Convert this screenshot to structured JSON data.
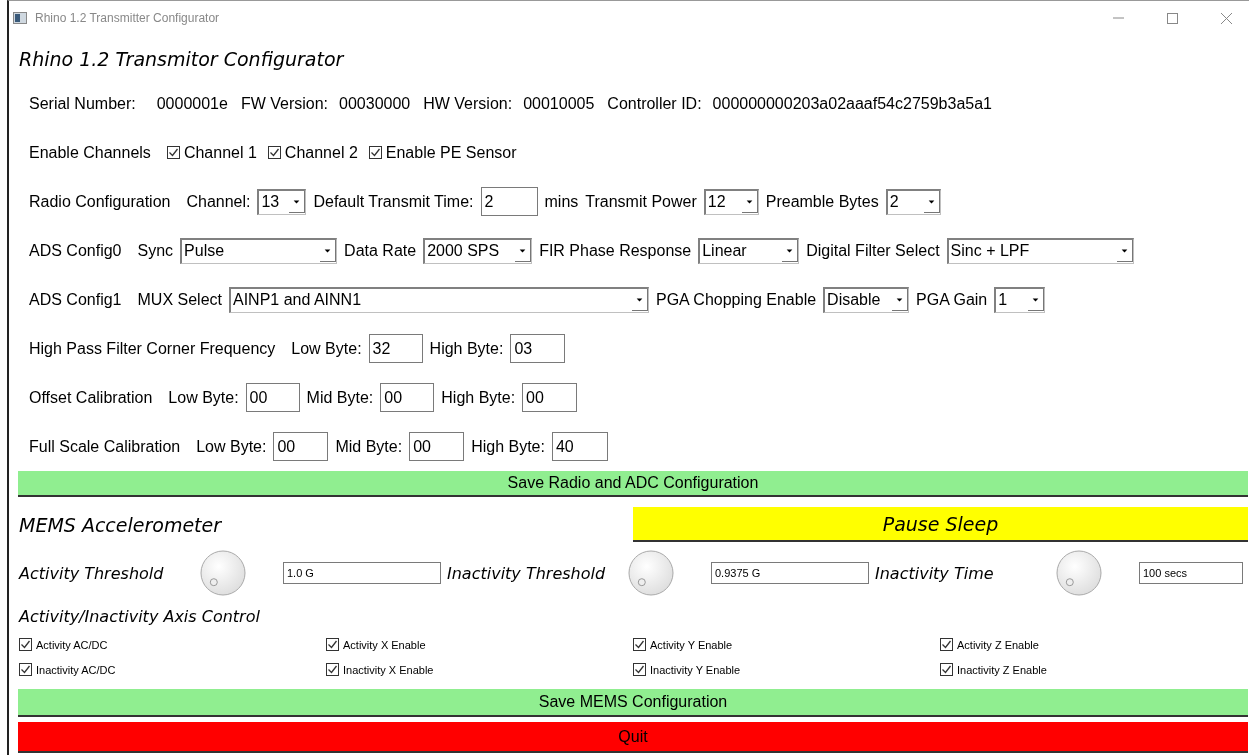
{
  "window": {
    "title": "Rhino 1.2 Transmitter Configurator"
  },
  "heading": "Rhino 1.2 Transmitor Configurator",
  "info": [
    {
      "label": "Serial Number:",
      "value": "0000001e"
    },
    {
      "label": "FW Version:",
      "value": "00030000"
    },
    {
      "label": "HW Version:",
      "value": "00010005"
    },
    {
      "label": "Controller ID:",
      "value": "000000000203a02aaaf54c2759b3a5a1"
    }
  ],
  "config_rows": [
    {
      "label": "Enable Channels",
      "items": [
        {
          "kind": "check",
          "text": "Channel 1",
          "checked": true
        },
        {
          "kind": "check",
          "text": "Channel 2",
          "checked": true
        },
        {
          "kind": "check",
          "text": "Enable PE Sensor",
          "checked": true
        }
      ]
    },
    {
      "label": "Radio Configuration",
      "items": [
        {
          "kind": "text",
          "text": "Channel:"
        },
        {
          "kind": "select",
          "value": "13"
        },
        {
          "kind": "text",
          "text": "Default Transmit Time:"
        },
        {
          "kind": "input",
          "value": "2"
        },
        {
          "kind": "text",
          "text": "mins"
        },
        {
          "kind": "text",
          "text": "Transmit Power"
        },
        {
          "kind": "select",
          "value": "12"
        },
        {
          "kind": "text",
          "text": "Preamble Bytes"
        },
        {
          "kind": "select",
          "value": "2"
        }
      ]
    },
    {
      "label": "ADS Config0",
      "items": [
        {
          "kind": "text",
          "text": "Sync"
        },
        {
          "kind": "select",
          "value": "Pulse"
        },
        {
          "kind": "text",
          "text": "Data Rate"
        },
        {
          "kind": "select",
          "value": "2000 SPS"
        },
        {
          "kind": "text",
          "text": "FIR Phase Response"
        },
        {
          "kind": "select",
          "value": "Linear"
        },
        {
          "kind": "text",
          "text": "Digital Filter Select"
        },
        {
          "kind": "select",
          "value": "Sinc + LPF"
        }
      ]
    },
    {
      "label": "ADS Config1",
      "items": [
        {
          "kind": "text",
          "text": "MUX Select"
        },
        {
          "kind": "select",
          "value": "AINP1 and AINN1"
        },
        {
          "kind": "text",
          "text": "PGA Chopping Enable"
        },
        {
          "kind": "select",
          "value": "Disable"
        },
        {
          "kind": "text",
          "text": "PGA Gain"
        },
        {
          "kind": "select",
          "value": "1"
        }
      ]
    },
    {
      "label": "High Pass Filter Corner Frequency",
      "items": [
        {
          "kind": "text",
          "text": "Low Byte:"
        },
        {
          "kind": "input",
          "value": "32"
        },
        {
          "kind": "text",
          "text": "High Byte:"
        },
        {
          "kind": "input",
          "value": "03"
        }
      ]
    },
    {
      "label": "Offset Calibration",
      "items": [
        {
          "kind": "text",
          "text": "Low Byte:"
        },
        {
          "kind": "input",
          "value": "00"
        },
        {
          "kind": "text",
          "text": "Mid Byte:"
        },
        {
          "kind": "input",
          "value": "00"
        },
        {
          "kind": "text",
          "text": "High Byte:"
        },
        {
          "kind": "input",
          "value": "00"
        }
      ]
    },
    {
      "label": "Full Scale Calibration",
      "items": [
        {
          "kind": "text",
          "text": "Low Byte:"
        },
        {
          "kind": "input",
          "value": "00"
        },
        {
          "kind": "text",
          "text": "Mid Byte:"
        },
        {
          "kind": "input",
          "value": "00"
        },
        {
          "kind": "text",
          "text": "High Byte:"
        },
        {
          "kind": "input",
          "value": "40"
        }
      ]
    }
  ],
  "save_adc_button": "Save Radio and ADC Configuration",
  "mems": {
    "title": "MEMS Accelerometer",
    "pause_button": "Pause Sleep",
    "dials": [
      {
        "label": "Activity Threshold",
        "value": "1.0 G"
      },
      {
        "label": "Inactivity Threshold",
        "value": "0.9375 G"
      },
      {
        "label": "Inactivity Time",
        "value": "100 secs"
      }
    ],
    "axis_title": "Activity/Inactivity Axis Control",
    "axis_checks": [
      {
        "text": "Activity AC/DC",
        "checked": true
      },
      {
        "text": "Activity X Enable",
        "checked": true
      },
      {
        "text": "Activity Y Enable",
        "checked": true
      },
      {
        "text": "Activity Z Enable",
        "checked": true
      },
      {
        "text": "Inactivity AC/DC",
        "checked": true
      },
      {
        "text": "Inactivity X Enable",
        "checked": true
      },
      {
        "text": "Inactivity Y Enable",
        "checked": true
      },
      {
        "text": "Inactivity Z Enable",
        "checked": true
      }
    ]
  },
  "save_mems_button": "Save MEMS Configuration",
  "quit_button": "Quit"
}
